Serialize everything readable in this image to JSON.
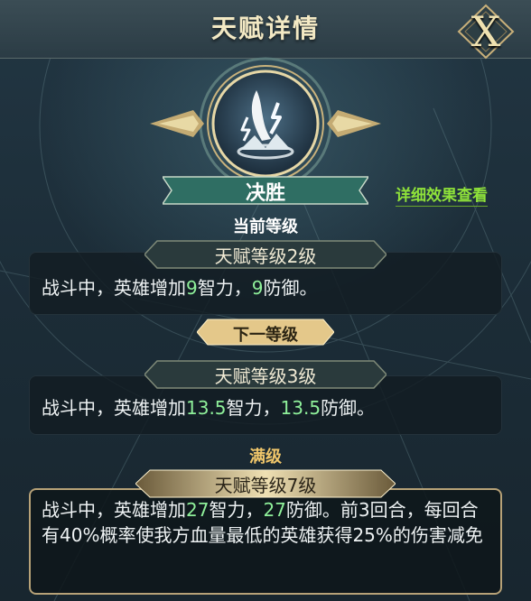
{
  "header": {
    "title": "天赋详情",
    "close_label": "X"
  },
  "talent": {
    "name": "决胜",
    "icon": "lightning-strike-icon"
  },
  "detail_link": "详细效果查看",
  "current": {
    "label": "当前等级",
    "level": "天赋等级2级",
    "desc": {
      "p1": "战斗中，英雄增加",
      "v1": "9",
      "p2": "智力，",
      "v2": "9",
      "p3": "防御。"
    }
  },
  "next": {
    "label": "下一等级",
    "level": "天赋等级3级",
    "desc": {
      "p1": "战斗中，英雄增加",
      "v1": "13.5",
      "p2": "智力，",
      "v2": "13.5",
      "p3": "防御。"
    }
  },
  "max": {
    "label": "满级",
    "level": "天赋等级7级",
    "desc": {
      "p1": "战斗中，英雄增加",
      "v1": "27",
      "p2": "智力，",
      "v2": "27",
      "p3": "防御。前3回合，每回合有40%概率使我方血量最低的英雄获得25%的伤害减免"
    }
  },
  "colors": {
    "accent_green": "#8ff09a",
    "link_green": "#8fe23a",
    "gold": "#f0c66a",
    "teal_banner": "#2f6e63"
  }
}
